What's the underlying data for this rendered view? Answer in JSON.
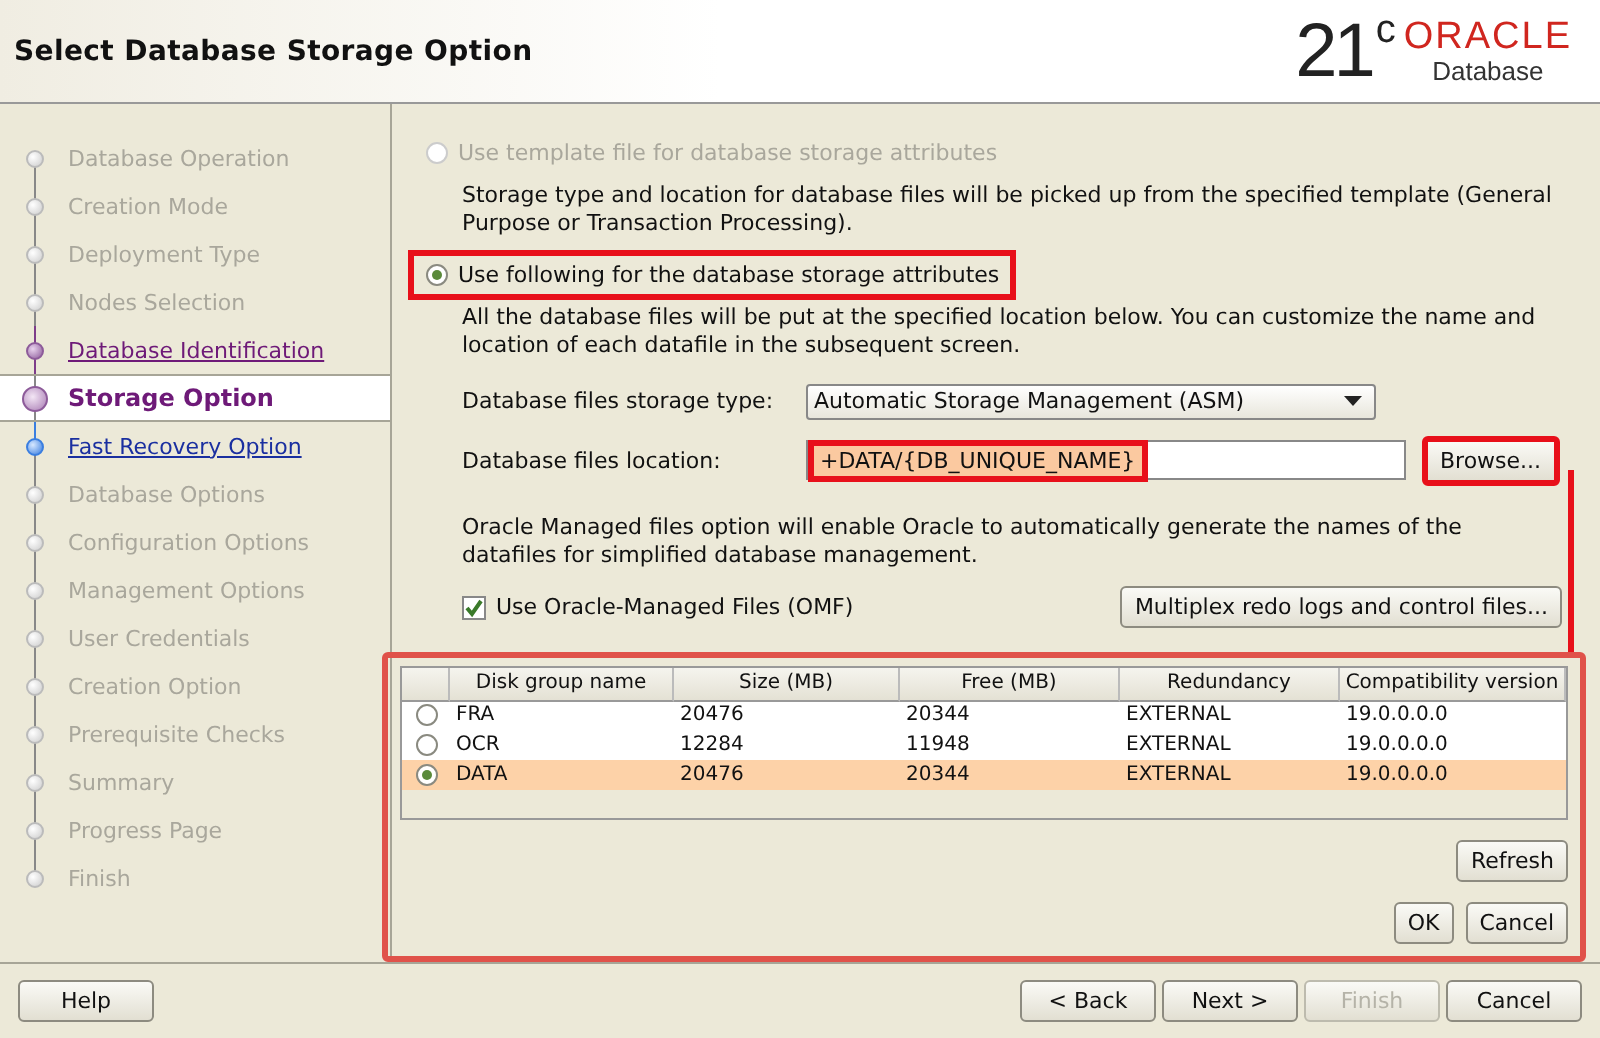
{
  "header": {
    "title": "Select Database Storage Option",
    "logo_version": "21",
    "logo_sup": "c",
    "logo_brand": "ORACLE",
    "logo_product": "Database"
  },
  "steps": [
    {
      "label": "Database Operation",
      "disabled": true,
      "visited": false,
      "selected": false
    },
    {
      "label": "Creation Mode",
      "disabled": true,
      "visited": false,
      "selected": false
    },
    {
      "label": "Deployment Type",
      "disabled": true,
      "visited": false,
      "selected": false
    },
    {
      "label": "Nodes Selection",
      "disabled": true,
      "visited": false,
      "selected": false
    },
    {
      "label": "Database Identification",
      "disabled": false,
      "visited": true,
      "selected": false
    },
    {
      "label": "Storage Option",
      "disabled": false,
      "visited": false,
      "selected": true
    },
    {
      "label": "Fast Recovery Option",
      "disabled": false,
      "visited": false,
      "selected": false
    },
    {
      "label": "Database Options",
      "disabled": true,
      "visited": false,
      "selected": false
    },
    {
      "label": "Configuration Options",
      "disabled": true,
      "visited": false,
      "selected": false
    },
    {
      "label": "Management Options",
      "disabled": true,
      "visited": false,
      "selected": false
    },
    {
      "label": "User Credentials",
      "disabled": true,
      "visited": false,
      "selected": false
    },
    {
      "label": "Creation Option",
      "disabled": true,
      "visited": false,
      "selected": false
    },
    {
      "label": "Prerequisite Checks",
      "disabled": true,
      "visited": false,
      "selected": false
    },
    {
      "label": "Summary",
      "disabled": true,
      "visited": false,
      "selected": false
    },
    {
      "label": "Progress Page",
      "disabled": true,
      "visited": false,
      "selected": false
    },
    {
      "label": "Finish",
      "disabled": true,
      "visited": false,
      "selected": false
    }
  ],
  "options": [
    {
      "label": "Use template file for database storage attributes",
      "selected": false,
      "disabled": true,
      "highlighted": false,
      "description": "Storage type and location for database files will be picked up from the specified template (General Purpose or Transaction Processing)."
    },
    {
      "label": "Use following for the database storage attributes",
      "selected": true,
      "disabled": false,
      "highlighted": true,
      "description": "All the database files will be put at the specified location below. You can customize the name and location of each datafile in the subsequent screen."
    }
  ],
  "storage_type": {
    "label": "Database files storage type:",
    "value": "Automatic Storage Management (ASM)"
  },
  "location": {
    "label": "Database files location:",
    "value": "+DATA/{DB_UNIQUE_NAME}",
    "highlighted": true
  },
  "browse_button": {
    "label": "Browse...",
    "highlighted": true
  },
  "omf_note": "Oracle Managed files option will enable Oracle to automatically generate the names of the datafiles for simplified database management.",
  "omf_checkbox": {
    "label": "Use Oracle-Managed Files (OMF)",
    "checked": true
  },
  "multiplex_button": "Multiplex redo logs and control files...",
  "disk_groups": {
    "highlighted": true,
    "columns": [
      "Disk group name",
      "Size (MB)",
      "Free (MB)",
      "Redundancy",
      "Compatibility version"
    ],
    "rows": [
      {
        "selected": false,
        "cells": [
          "FRA",
          "20476",
          "20344",
          "EXTERNAL",
          "19.0.0.0.0"
        ]
      },
      {
        "selected": false,
        "cells": [
          "OCR",
          "12284",
          "11948",
          "EXTERNAL",
          "19.0.0.0.0"
        ]
      },
      {
        "selected": true,
        "cells": [
          "DATA",
          "20476",
          "20344",
          "EXTERNAL",
          "19.0.0.0.0"
        ]
      }
    ],
    "refresh": "Refresh",
    "ok": "OK",
    "cancel": "Cancel"
  },
  "footer": {
    "help": "Help",
    "back": "< Back",
    "next": "Next >",
    "finish": {
      "label": "Finish",
      "disabled": true
    },
    "cancel": "Cancel"
  }
}
